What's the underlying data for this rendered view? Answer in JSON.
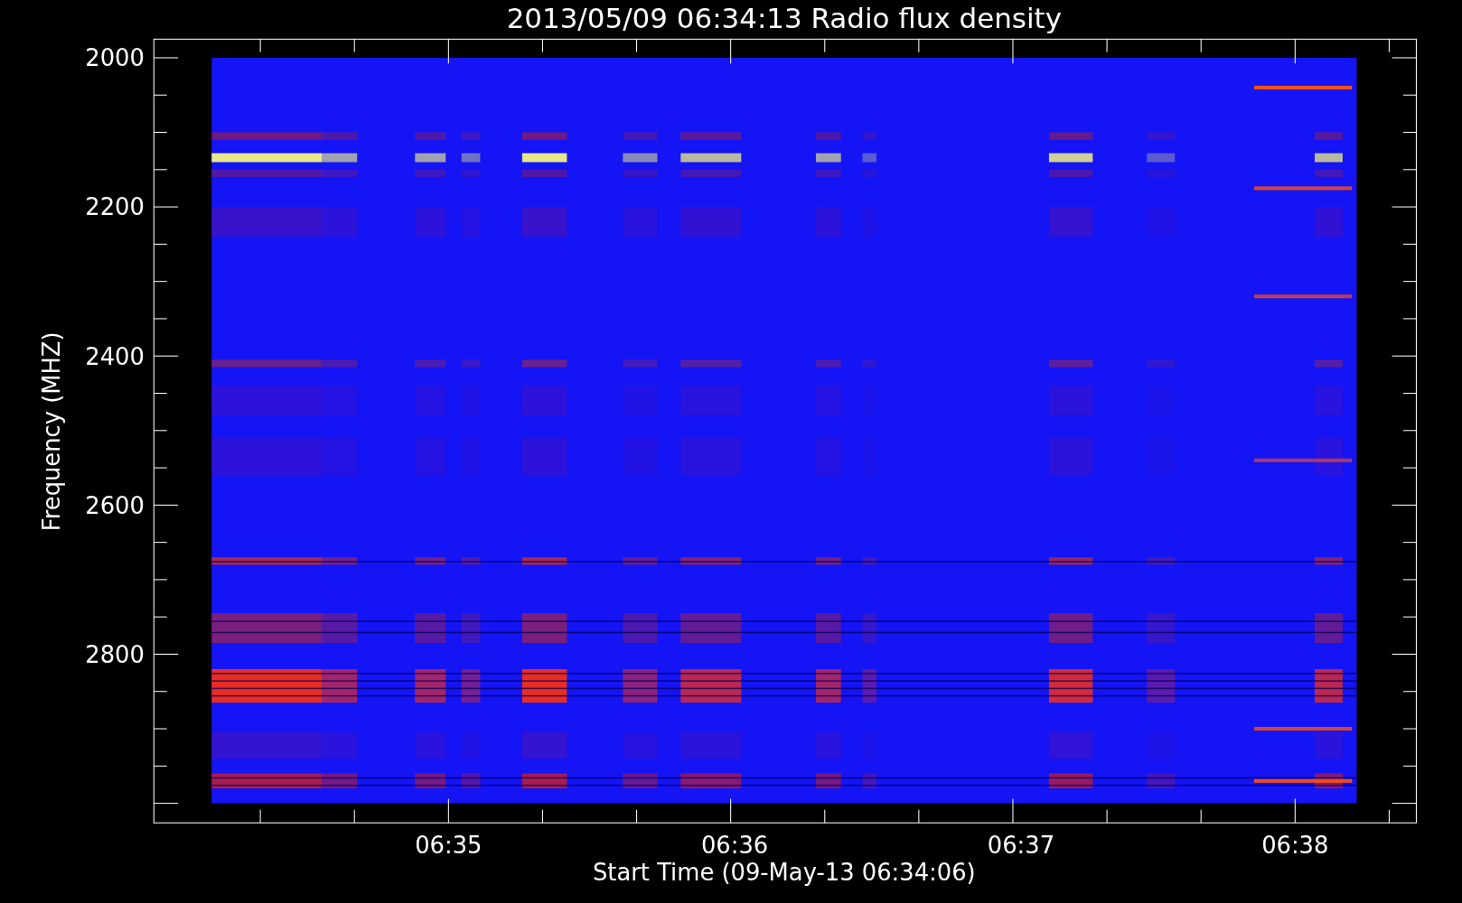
{
  "title": "2013/05/09 06:34:13 Radio flux density",
  "y_axis": {
    "label": "Frequency (MHZ)",
    "ticks": [
      "2000",
      "2200",
      "2400",
      "2600",
      "2800"
    ]
  },
  "x_axis": {
    "label": "Start Time (09-May-13 06:34:06)",
    "ticks": [
      "06:35",
      "06:36",
      "06:37",
      "06:38"
    ]
  }
}
